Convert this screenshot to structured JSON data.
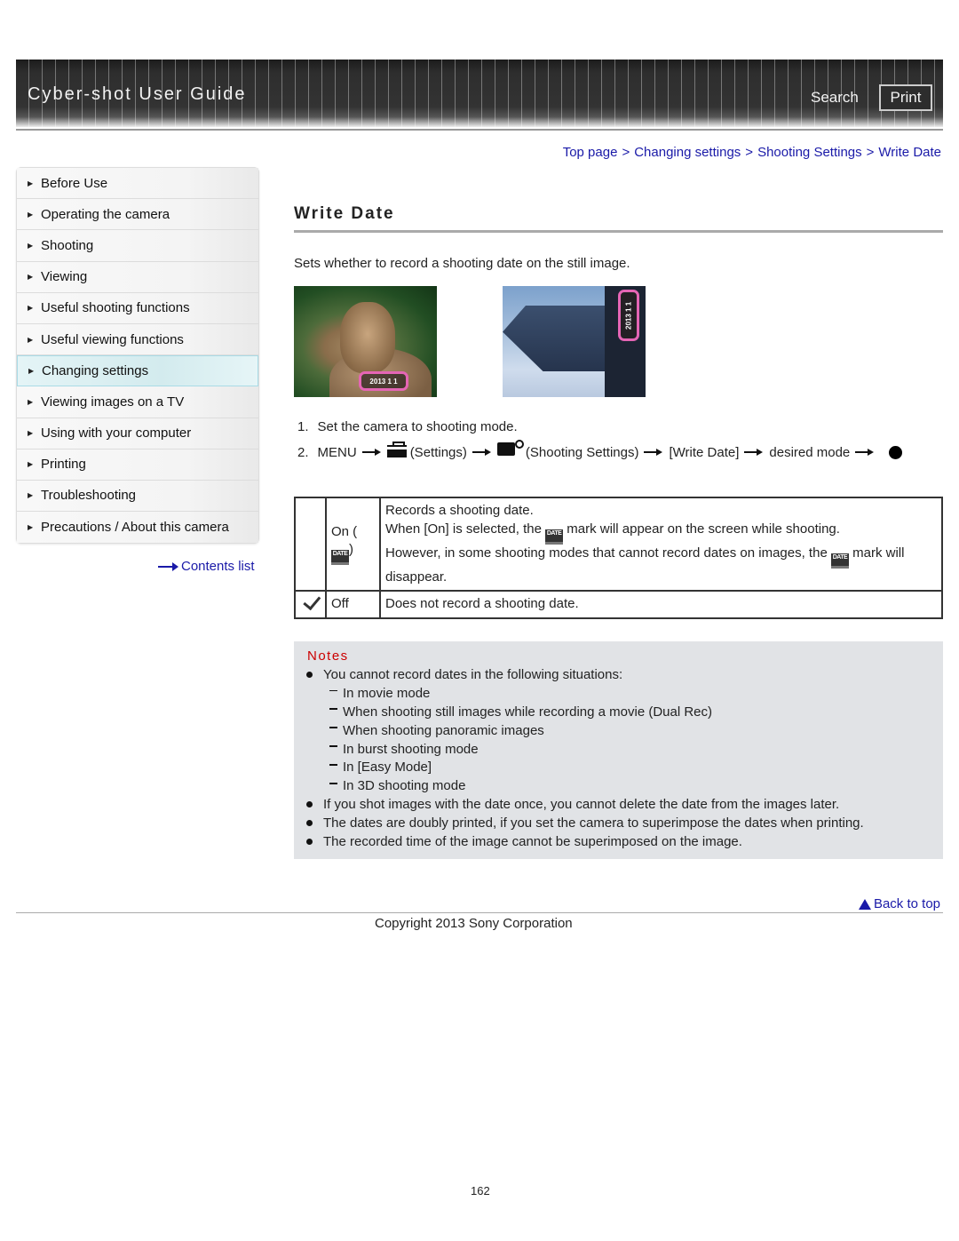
{
  "header": {
    "title": "Cyber-shot User Guide",
    "search_label": "Search",
    "print_label": "Print"
  },
  "breadcrumb": {
    "items": [
      "Top page",
      "Changing settings",
      "Shooting Settings",
      "Write Date"
    ],
    "separator": ">"
  },
  "sidebar": {
    "items": [
      {
        "label": "Before Use"
      },
      {
        "label": "Operating the camera"
      },
      {
        "label": "Shooting"
      },
      {
        "label": "Viewing"
      },
      {
        "label": "Useful shooting functions"
      },
      {
        "label": "Useful viewing functions"
      },
      {
        "label": "Changing settings",
        "active": true
      },
      {
        "label": "Viewing images on a TV"
      },
      {
        "label": "Using with your computer"
      },
      {
        "label": "Printing"
      },
      {
        "label": "Troubleshooting"
      },
      {
        "label": "Precautions / About this camera"
      }
    ],
    "contents_list_label": "Contents list"
  },
  "main": {
    "title": "Write Date",
    "intro": "Sets whether to record a shooting date on the still image.",
    "photos": [
      {
        "subject": "cat",
        "stamp": "2013 1 1"
      },
      {
        "subject": "building",
        "stamp": "2013 1 1"
      }
    ],
    "steps": [
      {
        "num": "1.",
        "text": "Set the camera to shooting mode."
      },
      {
        "num": "2.",
        "menu": "MENU",
        "settings": "(Settings)",
        "shooting_settings": "(Shooting Settings)",
        "write_date": "[Write Date]",
        "desired_mode": "desired mode"
      }
    ],
    "table": {
      "rows": [
        {
          "default": false,
          "option_prefix": "On (",
          "option_suffix": ")",
          "line1": "Records a shooting date.",
          "line2a": "When [On] is selected, the",
          "line2b": "mark will appear on the screen while shooting.",
          "line3a": "However, in some shooting modes that cannot record dates on images, the",
          "line3b": "mark will",
          "line4": "disappear."
        },
        {
          "default": true,
          "option": "Off",
          "description": "Does not record a shooting date."
        }
      ],
      "date_icon_label": "DATE"
    },
    "notes": {
      "title": "Notes",
      "items": [
        {
          "type": "bullet",
          "text": "You cannot record dates in the following situations:"
        },
        {
          "type": "sub",
          "text": "In movie mode"
        },
        {
          "type": "sub",
          "text": "When shooting still images while recording a movie (Dual Rec)"
        },
        {
          "type": "sub",
          "text": "When shooting panoramic images"
        },
        {
          "type": "sub",
          "text": "In burst shooting mode"
        },
        {
          "type": "sub",
          "text": "In [Easy Mode]"
        },
        {
          "type": "sub",
          "text": "In 3D shooting mode"
        },
        {
          "type": "bullet",
          "text": "If you shot images with the date once, you cannot delete the date from the images later."
        },
        {
          "type": "bullet",
          "text": "The dates are doubly printed, if you set the camera to superimpose the dates when printing."
        },
        {
          "type": "bullet",
          "text": "The recorded time of the image cannot be superimposed on the image."
        }
      ]
    }
  },
  "footer": {
    "back_to_top": "Back to top",
    "copyright": "Copyright 2013 Sony Corporation",
    "page_number": "162"
  },
  "colors": {
    "link": "#1a1aa8",
    "notes_title": "#cc0000",
    "notes_bg": "#e1e3e6",
    "active_sidebar": "#d3ebee",
    "header_bg": "#333333"
  }
}
